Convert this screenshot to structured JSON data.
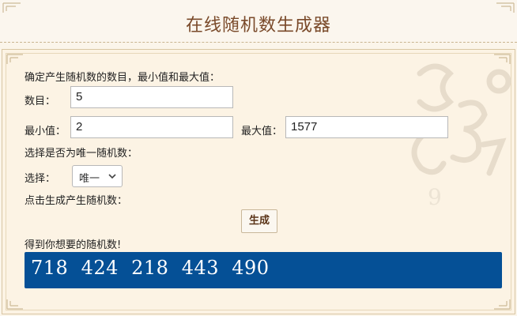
{
  "header": {
    "title": "在线随机数生成器"
  },
  "form": {
    "intro": "确定产生随机数的数目，最小值和最大值：",
    "count_label": "数目：",
    "count_value": "5",
    "min_label": "最小值：",
    "min_value": "2",
    "max_label": "最大值：",
    "max_value": "1577",
    "unique_prompt": "选择是否为唯一随机数：",
    "select_label": "选择：",
    "select_value": "唯一",
    "generate_prompt": "点击生成产生随机数：",
    "generate_button": "生成",
    "result_label": "得到你想要的随机数!"
  },
  "result": {
    "numbers_text": "718  424  218  443  490"
  },
  "colors": {
    "result_bg": "#055096",
    "title": "#7a4a2a",
    "page_bg": "#fbf5ea"
  },
  "icons": {
    "select_arrow": "chevron-down-icon"
  }
}
